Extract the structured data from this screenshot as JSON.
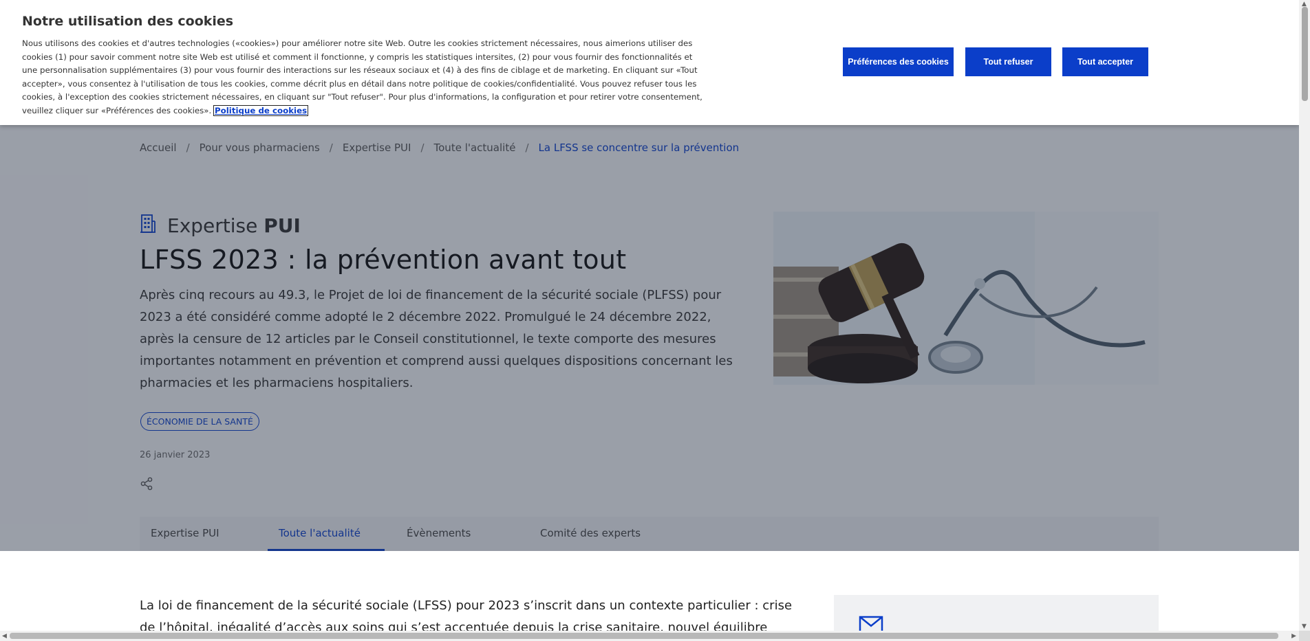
{
  "breadcrumb": {
    "items": [
      "Accueil",
      "Pour vous pharmaciens",
      "Expertise PUI",
      "Toute l'actualité"
    ],
    "separator": "/",
    "current": "La LFSS se concentre sur la prévention"
  },
  "article": {
    "section_icon": "building-icon",
    "section_light": "Expertise",
    "section_bold": "PUI",
    "title": "LFSS 2023 : la prévention avant tout",
    "intro": "Après cinq recours au 49.3, le Projet de loi de financement de la sécurité sociale (PLFSS) pour 2023 a été considéré comme adopté le 2 décembre 2022. Promulgué le 24 décembre 2022, après la censure de 12 articles par le Conseil constitutionnel, le texte comporte des mesures importantes notamment en prévention et comprend aussi quelques dispositions concernant les pharmacies et les pharmaciens hospitaliers.",
    "tag": "ÉCONOMIE DE LA SANTÉ",
    "date": "26 janvier 2023",
    "body": "La loi de financement de la sécurité sociale (LFSS) pour 2023 s’inscrit dans un contexte particulier : crise de l’hôpital, inégalité d’accès aux soins qui s’est accentuée depuis la crise sanitaire, nouvel équilibre politique à l’Assemblée"
  },
  "tabs": [
    {
      "label": "Expertise PUI",
      "active": false
    },
    {
      "label": "Toute l'actualité",
      "active": true
    },
    {
      "label": "Évènements",
      "active": false
    },
    {
      "label": "Comité des experts",
      "active": false
    }
  ],
  "cookie_banner": {
    "title": "Notre utilisation des cookies",
    "text": "Nous utilisons des cookies et d'autres technologies («cookies») pour améliorer notre site Web. Outre les cookies strictement nécessaires, nous aimerions utiliser des cookies (1) pour savoir comment notre site Web est utilisé et comment il fonctionne, y compris les statistiques intersites, (2) pour vous fournir des fonctionnalités et une personnalisation supplémentaires (3) pour vous fournir des interactions sur les réseaux sociaux et (4) à des fins de ciblage et de marketing. En cliquant sur «Tout accepter», vous consentez à l'utilisation de tous les cookies, comme décrit plus en détail dans notre politique de cookies/confidentialité. Vous pouvez refuser tous les cookies, à l'exception des cookies strictement nécessaires, en cliquant sur \"Tout refuser\". Pour plus d'informations, la configuration et pour retirer votre consentement, veuillez cliquer sur «Préférences des cookies».",
    "policy_link": "Politique de cookies",
    "buttons": {
      "preferences": "Préférences des cookies",
      "reject": "Tout refuser",
      "accept": "Tout accepter"
    }
  },
  "colors": {
    "accent": "#0b3ec9",
    "overlay": "rgba(30,40,60,0.42)",
    "hero_background": "#f3f4f6"
  },
  "icons": {
    "share": "share-icon",
    "mail": "mail-icon",
    "section": "building-icon"
  }
}
